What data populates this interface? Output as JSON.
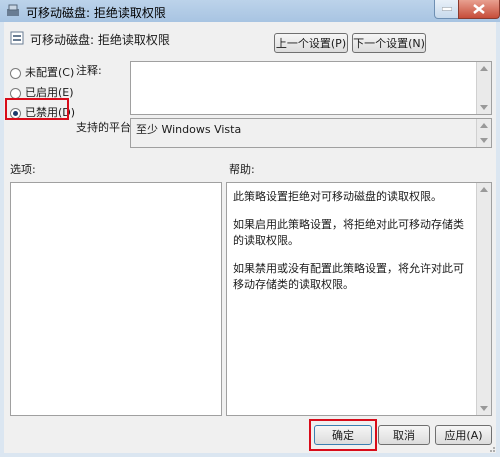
{
  "window": {
    "title": "可移动磁盘: 拒绝读取权限",
    "header_title": "可移动磁盘: 拒绝读取权限"
  },
  "nav": {
    "prev_label": "上一个设置(P)",
    "next_label": "下一个设置(N)"
  },
  "state": {
    "options": [
      {
        "label": "未配置(C)",
        "selected": false
      },
      {
        "label": "已启用(E)",
        "selected": false
      },
      {
        "label": "已禁用(D)",
        "selected": true
      }
    ]
  },
  "comment": {
    "label": "注释:",
    "value": ""
  },
  "platform": {
    "label": "支持的平台:",
    "value": "至少 Windows Vista"
  },
  "options_panel": {
    "label": "选项:"
  },
  "help_panel": {
    "label": "帮助:",
    "paragraphs": [
      "此策略设置拒绝对可移动磁盘的读取权限。",
      "如果启用此策略设置，将拒绝对此可移动存储类的读取权限。",
      "如果禁用或没有配置此策略设置，将允许对此可移动存储类的读取权限。"
    ]
  },
  "footer": {
    "ok_label": "确定",
    "cancel_label": "取消",
    "apply_label": "应用(A)"
  },
  "colors": {
    "highlight": "#d80c1a",
    "title_bar": "#bcd3ea"
  }
}
